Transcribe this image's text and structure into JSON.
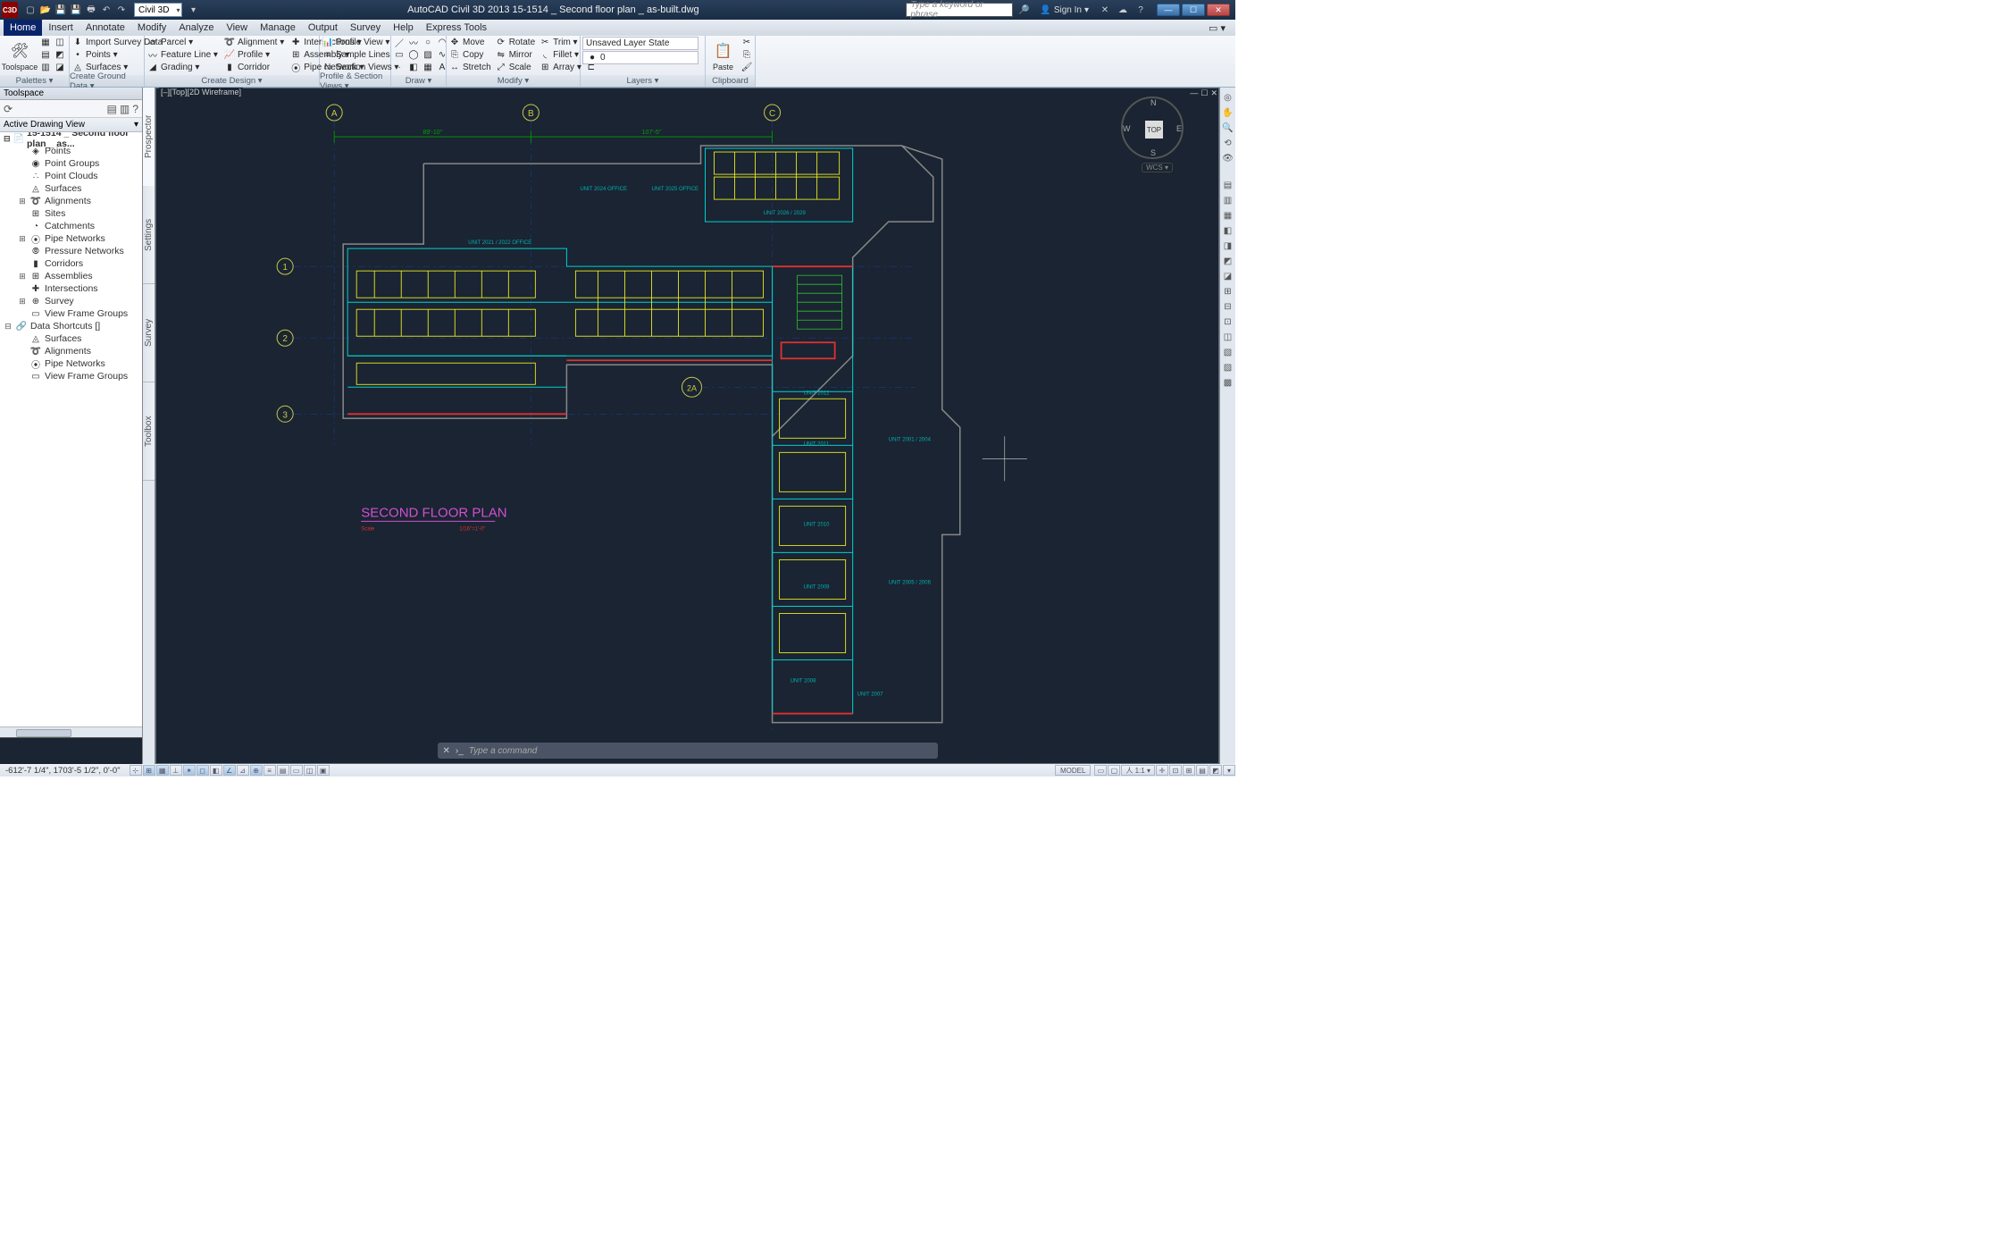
{
  "app": {
    "logo": "C3D",
    "workspace": "Civil 3D",
    "title_center": "AutoCAD Civil 3D 2013    15-1514 _ Second floor plan _ as-built.dwg",
    "search_placeholder": "Type a keyword or phrase",
    "signin": "Sign In"
  },
  "menus": [
    "Home",
    "Insert",
    "Annotate",
    "Modify",
    "Analyze",
    "View",
    "Manage",
    "Output",
    "Survey",
    "Help",
    "Express Tools"
  ],
  "ribbon": {
    "palettes": {
      "big": "Toolspace",
      "title": "Palettes ▾"
    },
    "create_gd": {
      "items": [
        "Import Survey Data",
        "Points ▾",
        "Surfaces ▾",
        "Parcel ▾",
        "Feature Line ▾",
        "Grading ▾",
        "Alignment ▾",
        "Profile ▾",
        "Corridor",
        "Intersections ▾",
        "Assembly ▾",
        "Pipe Network ▾"
      ],
      "title": "Create Ground Data ▾",
      "title2": "Create Design ▾"
    },
    "psv": {
      "items": [
        "Profile View ▾",
        "Sample Lines",
        "Section Views ▾"
      ],
      "title": "Profile & Section Views ▾"
    },
    "draw": {
      "title": "Draw ▾"
    },
    "modify": {
      "items": [
        "Move",
        "Copy",
        "Stretch",
        "Rotate",
        "Mirror",
        "Scale",
        "Trim ▾",
        "Fillet ▾",
        "Array ▾"
      ],
      "title": "Modify ▾"
    },
    "layers": {
      "state": "Unsaved Layer State",
      "layer": "0",
      "title": "Layers ▾"
    },
    "clip": {
      "big": "Paste",
      "title": "Clipboard"
    }
  },
  "toolspace": {
    "title": "Toolspace",
    "adv": "Active Drawing View",
    "file": "15-1514 _ Second floor plan _ as...",
    "items": [
      "Points",
      "Point Groups",
      "Point Clouds",
      "Surfaces",
      "Alignments",
      "Sites",
      "Catchments",
      "Pipe Networks",
      "Pressure Networks",
      "Corridors",
      "Assemblies",
      "Intersections",
      "Survey",
      "View Frame Groups"
    ],
    "shortcuts": "Data Shortcuts []",
    "sc_items": [
      "Surfaces",
      "Alignments",
      "Pipe Networks",
      "View Frame Groups"
    ]
  },
  "vtabs": [
    "Prospector",
    "Settings",
    "Survey",
    "Toolbox"
  ],
  "drawing": {
    "tag": "[–][Top][2D Wireframe]",
    "grids": {
      "cols": [
        "A",
        "B",
        "C"
      ],
      "rows": [
        "1",
        "2",
        "3"
      ],
      "extra": "2A"
    },
    "dims": [
      "89'-10\"",
      "107'-5\""
    ],
    "units": [
      "UNIT 2021 / 2022 OFFICE",
      "UNIT 2024 OFFICE",
      "UNIT 2025 OFFICE",
      "UNIT 2026 / 2029",
      "UNIT 2012",
      "UNIT 2011",
      "UNIT 2010",
      "UNIT 2009",
      "UNIT 2008",
      "UNIT 2007",
      "UNIT 2001 / 2004",
      "UNIT 2005 / 2006"
    ],
    "plan_title": "SECOND FLOOR PLAN",
    "plan_scale": "Scale",
    "plan_ratio": "1/16\"=1'-0\""
  },
  "viewcube": {
    "top": "TOP",
    "n": "N",
    "s": "S",
    "e": "E",
    "w": "W",
    "wcs": "WCS ▾"
  },
  "cmdline": "Type a command",
  "status": {
    "coords": "-612'-7 1/4\", 1703'-5 1/2\", 0'-0\"",
    "model": "MODEL"
  }
}
